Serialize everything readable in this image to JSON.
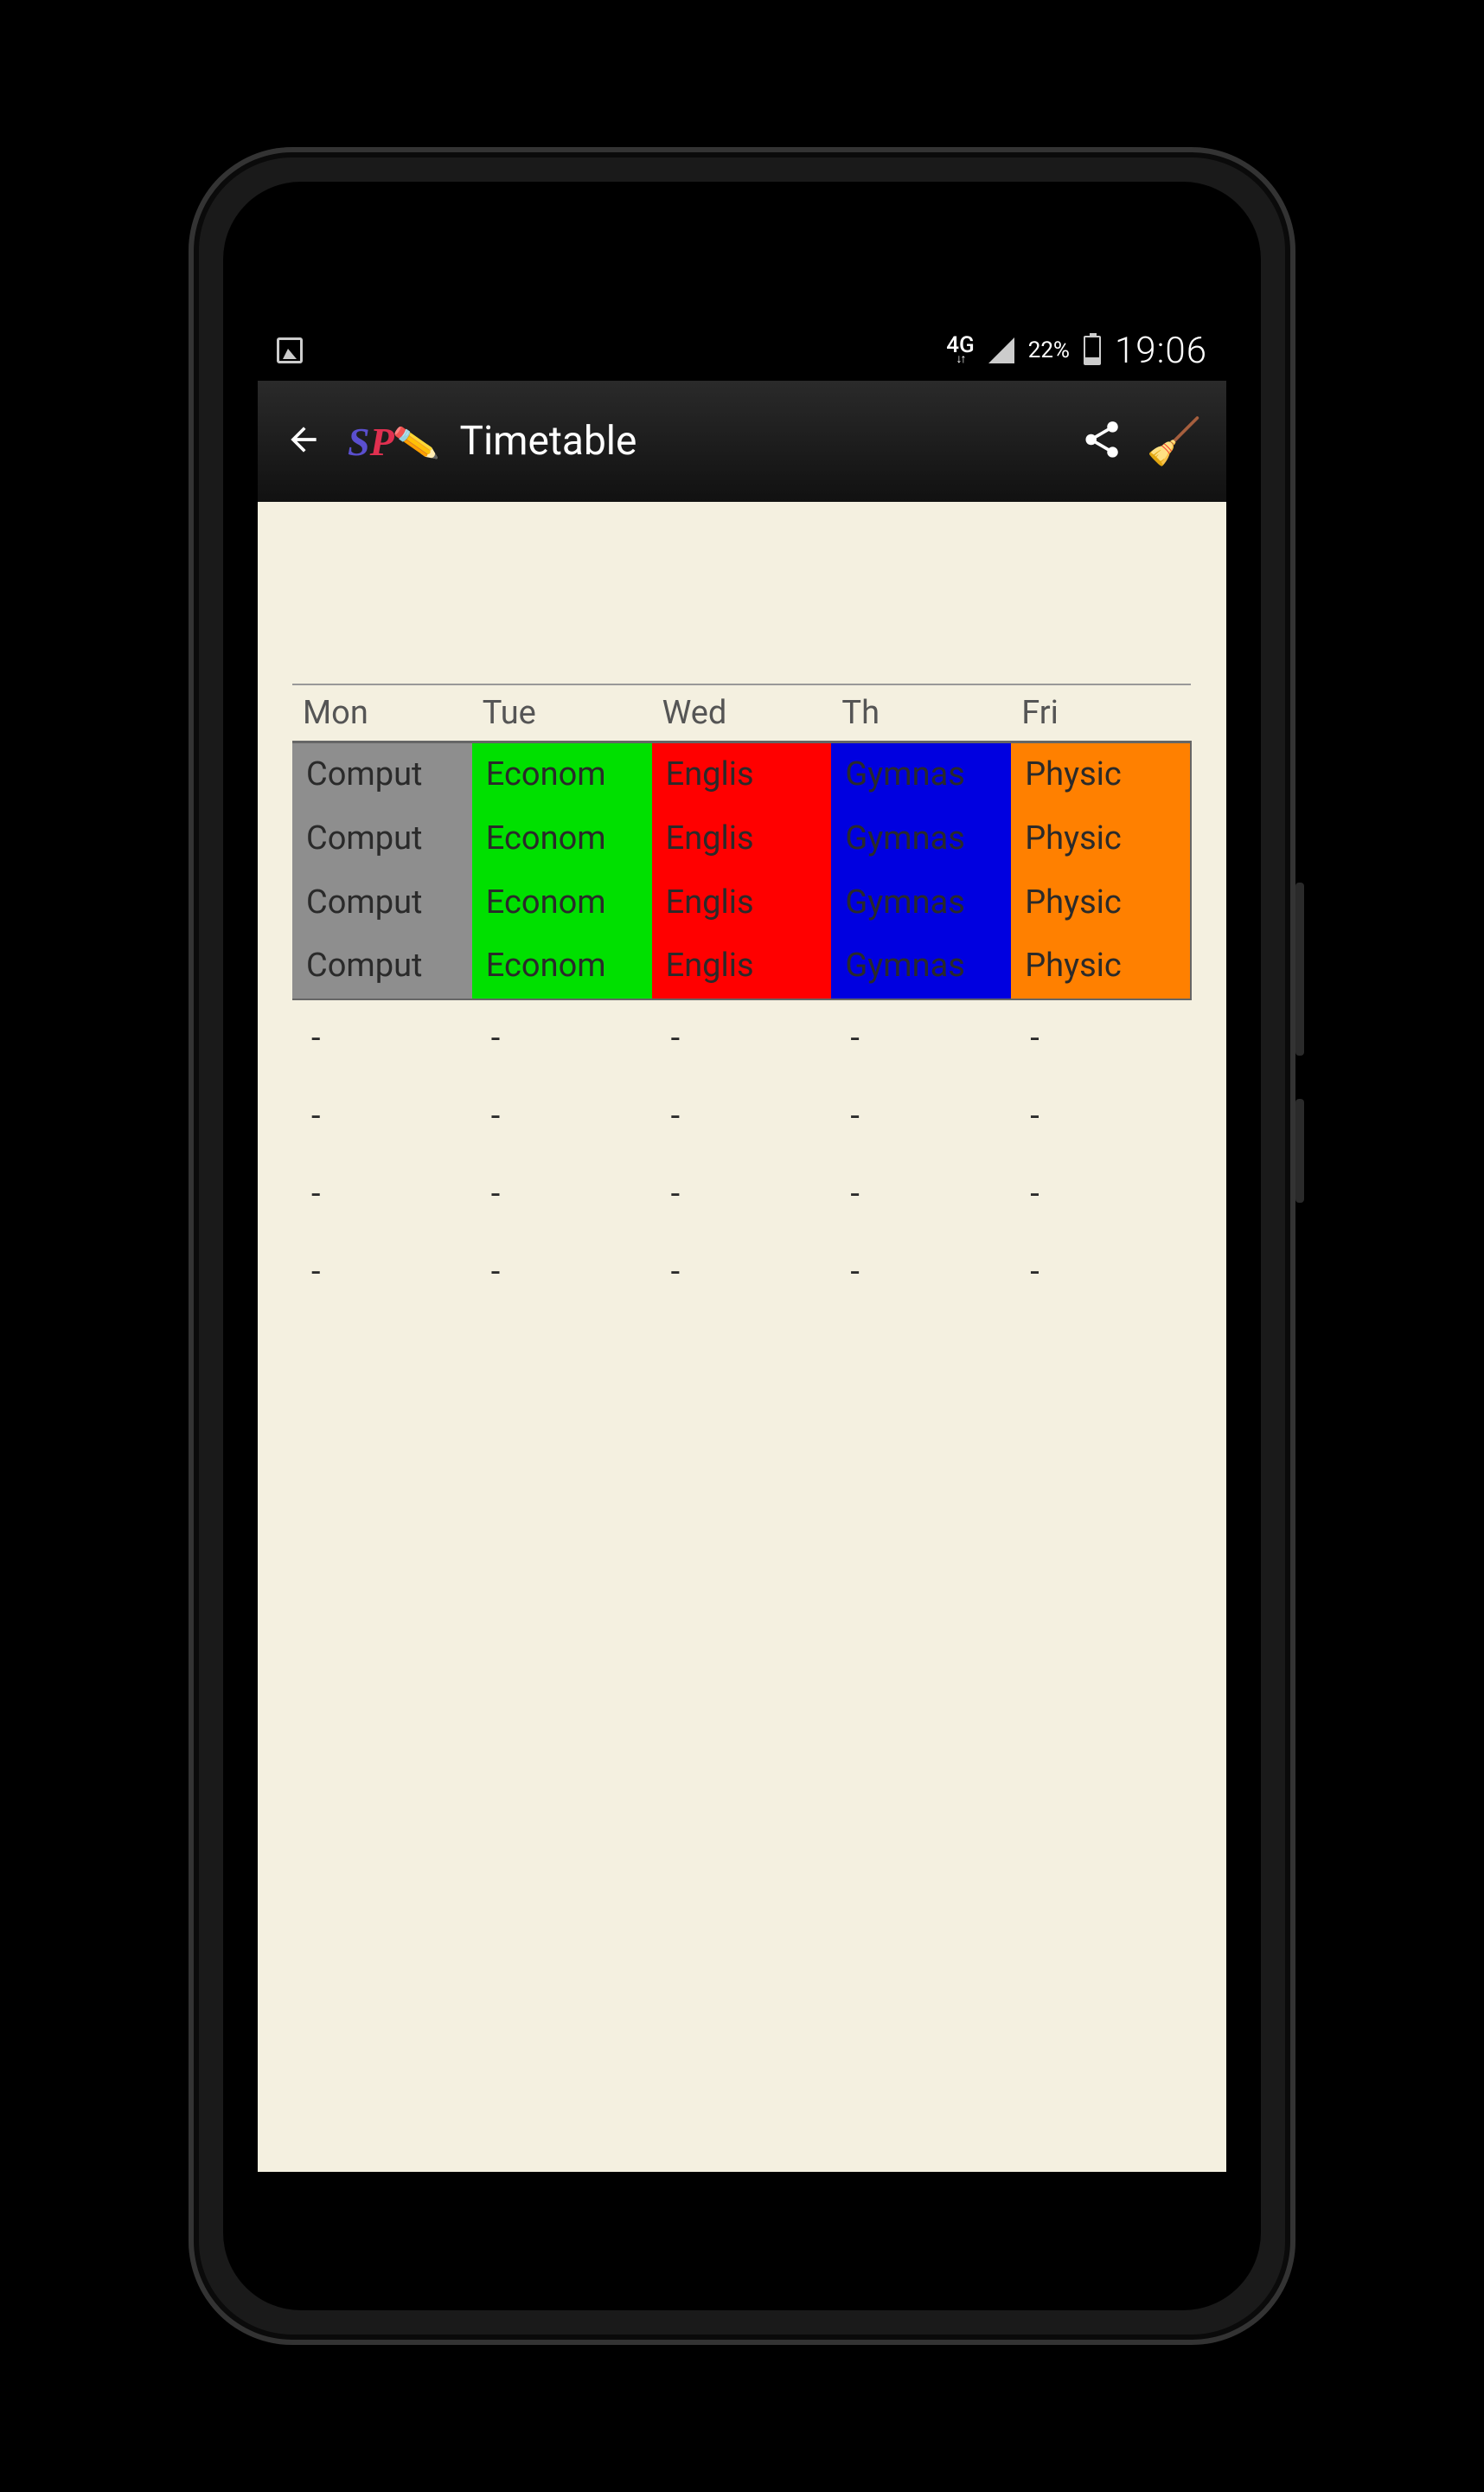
{
  "statusbar": {
    "network": "4G",
    "battery_pct": "22%",
    "time": "19:06"
  },
  "appbar": {
    "logo_s": "S",
    "logo_p": "P",
    "title": "Timetable"
  },
  "timetable": {
    "headers": [
      "Mon",
      "Tue",
      "Wed",
      "Th",
      "Fri"
    ],
    "colors": [
      "#8e8e8e",
      "#00e000",
      "#ff0000",
      "#0000e0",
      "#ff8000"
    ],
    "rows": [
      [
        "Comput",
        "Econom",
        "Englis",
        "Gymnas",
        "Physic"
      ],
      [
        "Comput",
        "Econom",
        "Englis",
        "Gymnas",
        "Physic"
      ],
      [
        "Comput",
        "Econom",
        "Englis",
        "Gymnas",
        "Physic"
      ],
      [
        "Comput",
        "Econom",
        "Englis",
        "Gymnas",
        "Physic"
      ]
    ],
    "empty_rows": [
      [
        "-",
        "-",
        "-",
        "-",
        "-"
      ],
      [
        "-",
        "-",
        "-",
        "-",
        "-"
      ],
      [
        "-",
        "-",
        "-",
        "-",
        "-"
      ],
      [
        "-",
        "-",
        "-",
        "-",
        "-"
      ]
    ]
  }
}
